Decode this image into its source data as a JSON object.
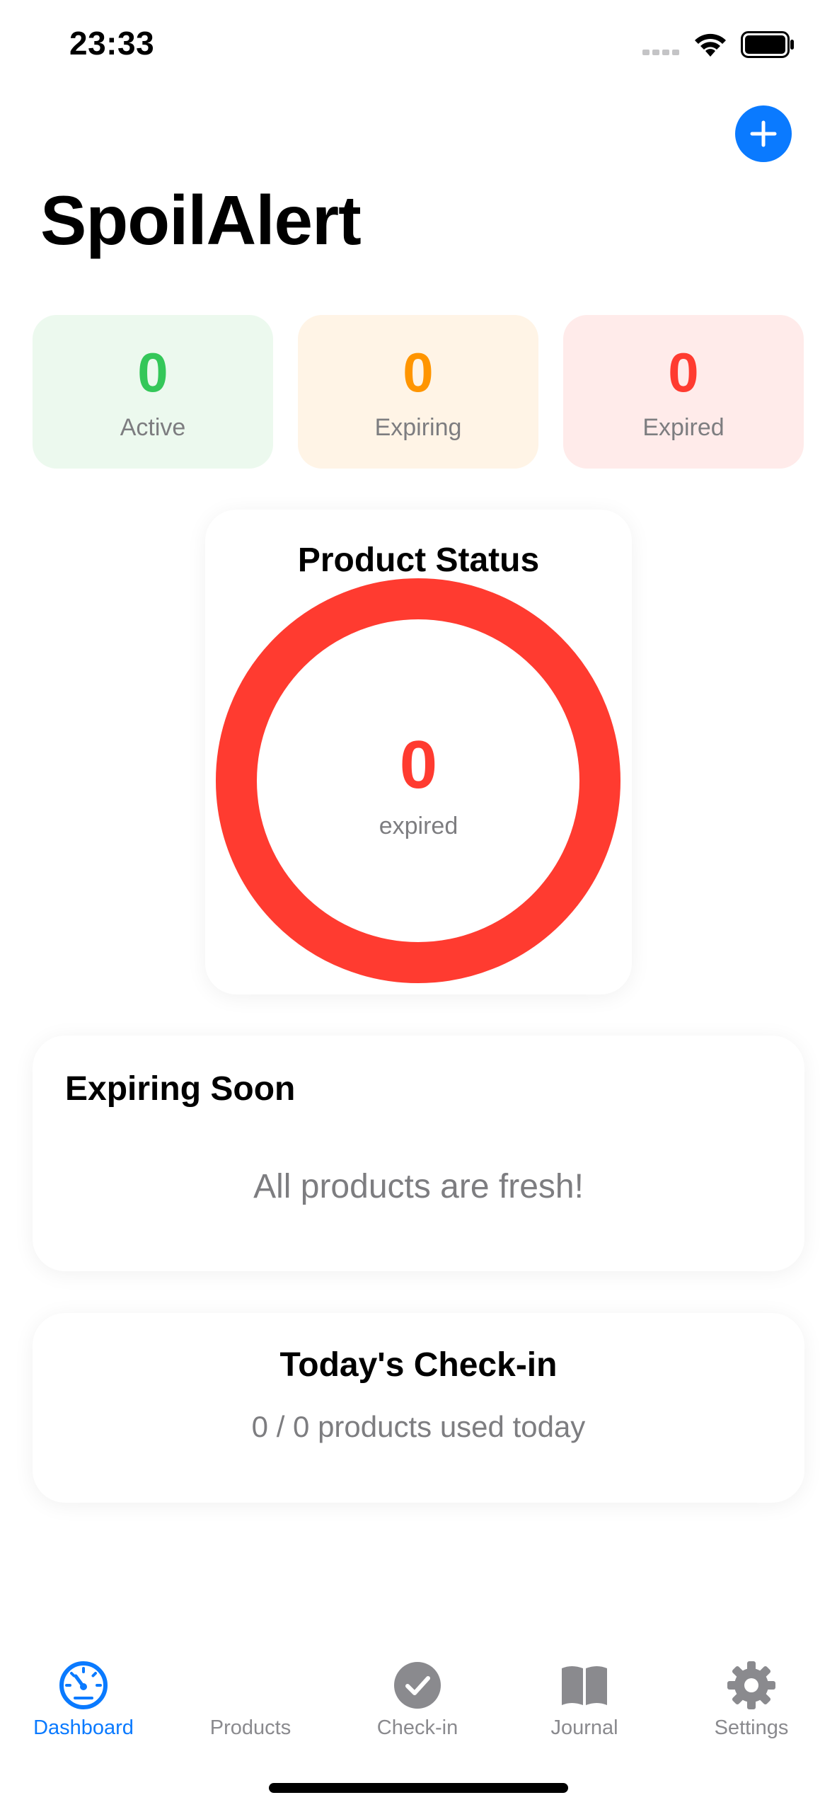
{
  "status_bar": {
    "time": "23:33"
  },
  "header": {
    "title": "SpoilAlert",
    "add_icon": "plus-icon"
  },
  "stats": [
    {
      "value": "0",
      "label": "Active",
      "color": "#34c759",
      "bg": "#ecf9ee"
    },
    {
      "value": "0",
      "label": "Expiring",
      "color": "#ff9500",
      "bg": "#fff4e6"
    },
    {
      "value": "0",
      "label": "Expired",
      "color": "#ff3b30",
      "bg": "#ffebea"
    }
  ],
  "product_status": {
    "title": "Product Status",
    "value": "0",
    "label": "expired",
    "ring_color": "#ff3b30",
    "ring_fill_fraction": 1.0
  },
  "expiring_soon": {
    "title": "Expiring Soon",
    "empty_message": "All products are fresh!"
  },
  "checkin": {
    "title": "Today's Check-in",
    "summary": "0 / 0 products used today"
  },
  "tabs": [
    {
      "label": "Dashboard",
      "icon": "gauge-icon",
      "active": true
    },
    {
      "label": "Products",
      "icon": "",
      "active": false
    },
    {
      "label": "Check-in",
      "icon": "checkmark-circle-icon",
      "active": false
    },
    {
      "label": "Journal",
      "icon": "book-icon",
      "active": false
    },
    {
      "label": "Settings",
      "icon": "gear-icon",
      "active": false
    }
  ],
  "colors": {
    "accent": "#0a7aff",
    "secondary_text": "#7d7d80"
  }
}
